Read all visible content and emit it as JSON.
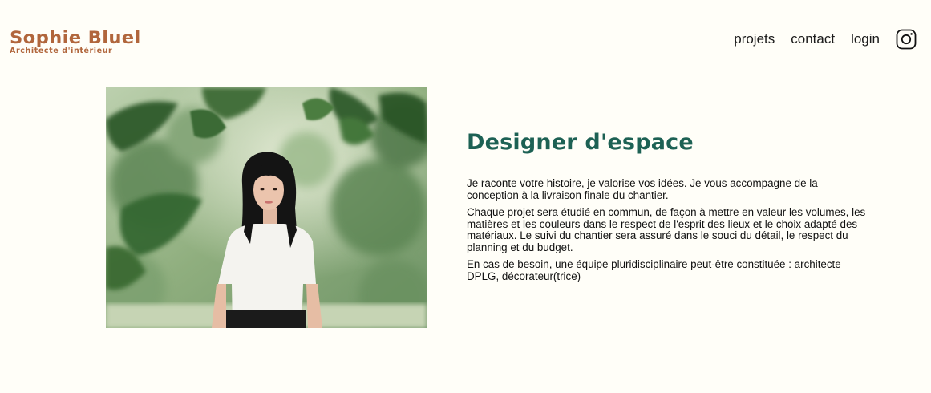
{
  "header": {
    "logo_name": "Sophie Bluel",
    "logo_subtitle": "Architecte d'intérieur",
    "nav": {
      "projects": "projets",
      "contact": "contact",
      "login": "login",
      "instagram_icon": "instagram-icon"
    }
  },
  "intro": {
    "title": "Designer d'espace",
    "paragraphs": [
      "Je raconte votre histoire, je valorise vos idées. Je vous accompagne de la conception à la livraison finale du chantier.",
      "Chaque projet sera étudié en commun, de façon à mettre en valeur les volumes, les matières et les couleurs dans le respect de l'esprit des lieux et le choix adapté des matériaux. Le suivi du chantier sera assuré dans le souci du détail, le respect du planning et du budget.",
      "En cas de besoin, une équipe pluridisciplinaire peut-être constituée : architecte DPLG, décorateur(trice)"
    ]
  },
  "colors": {
    "brand": "#B1663C",
    "title": "#1D6154",
    "background": "#FFFEF8"
  }
}
